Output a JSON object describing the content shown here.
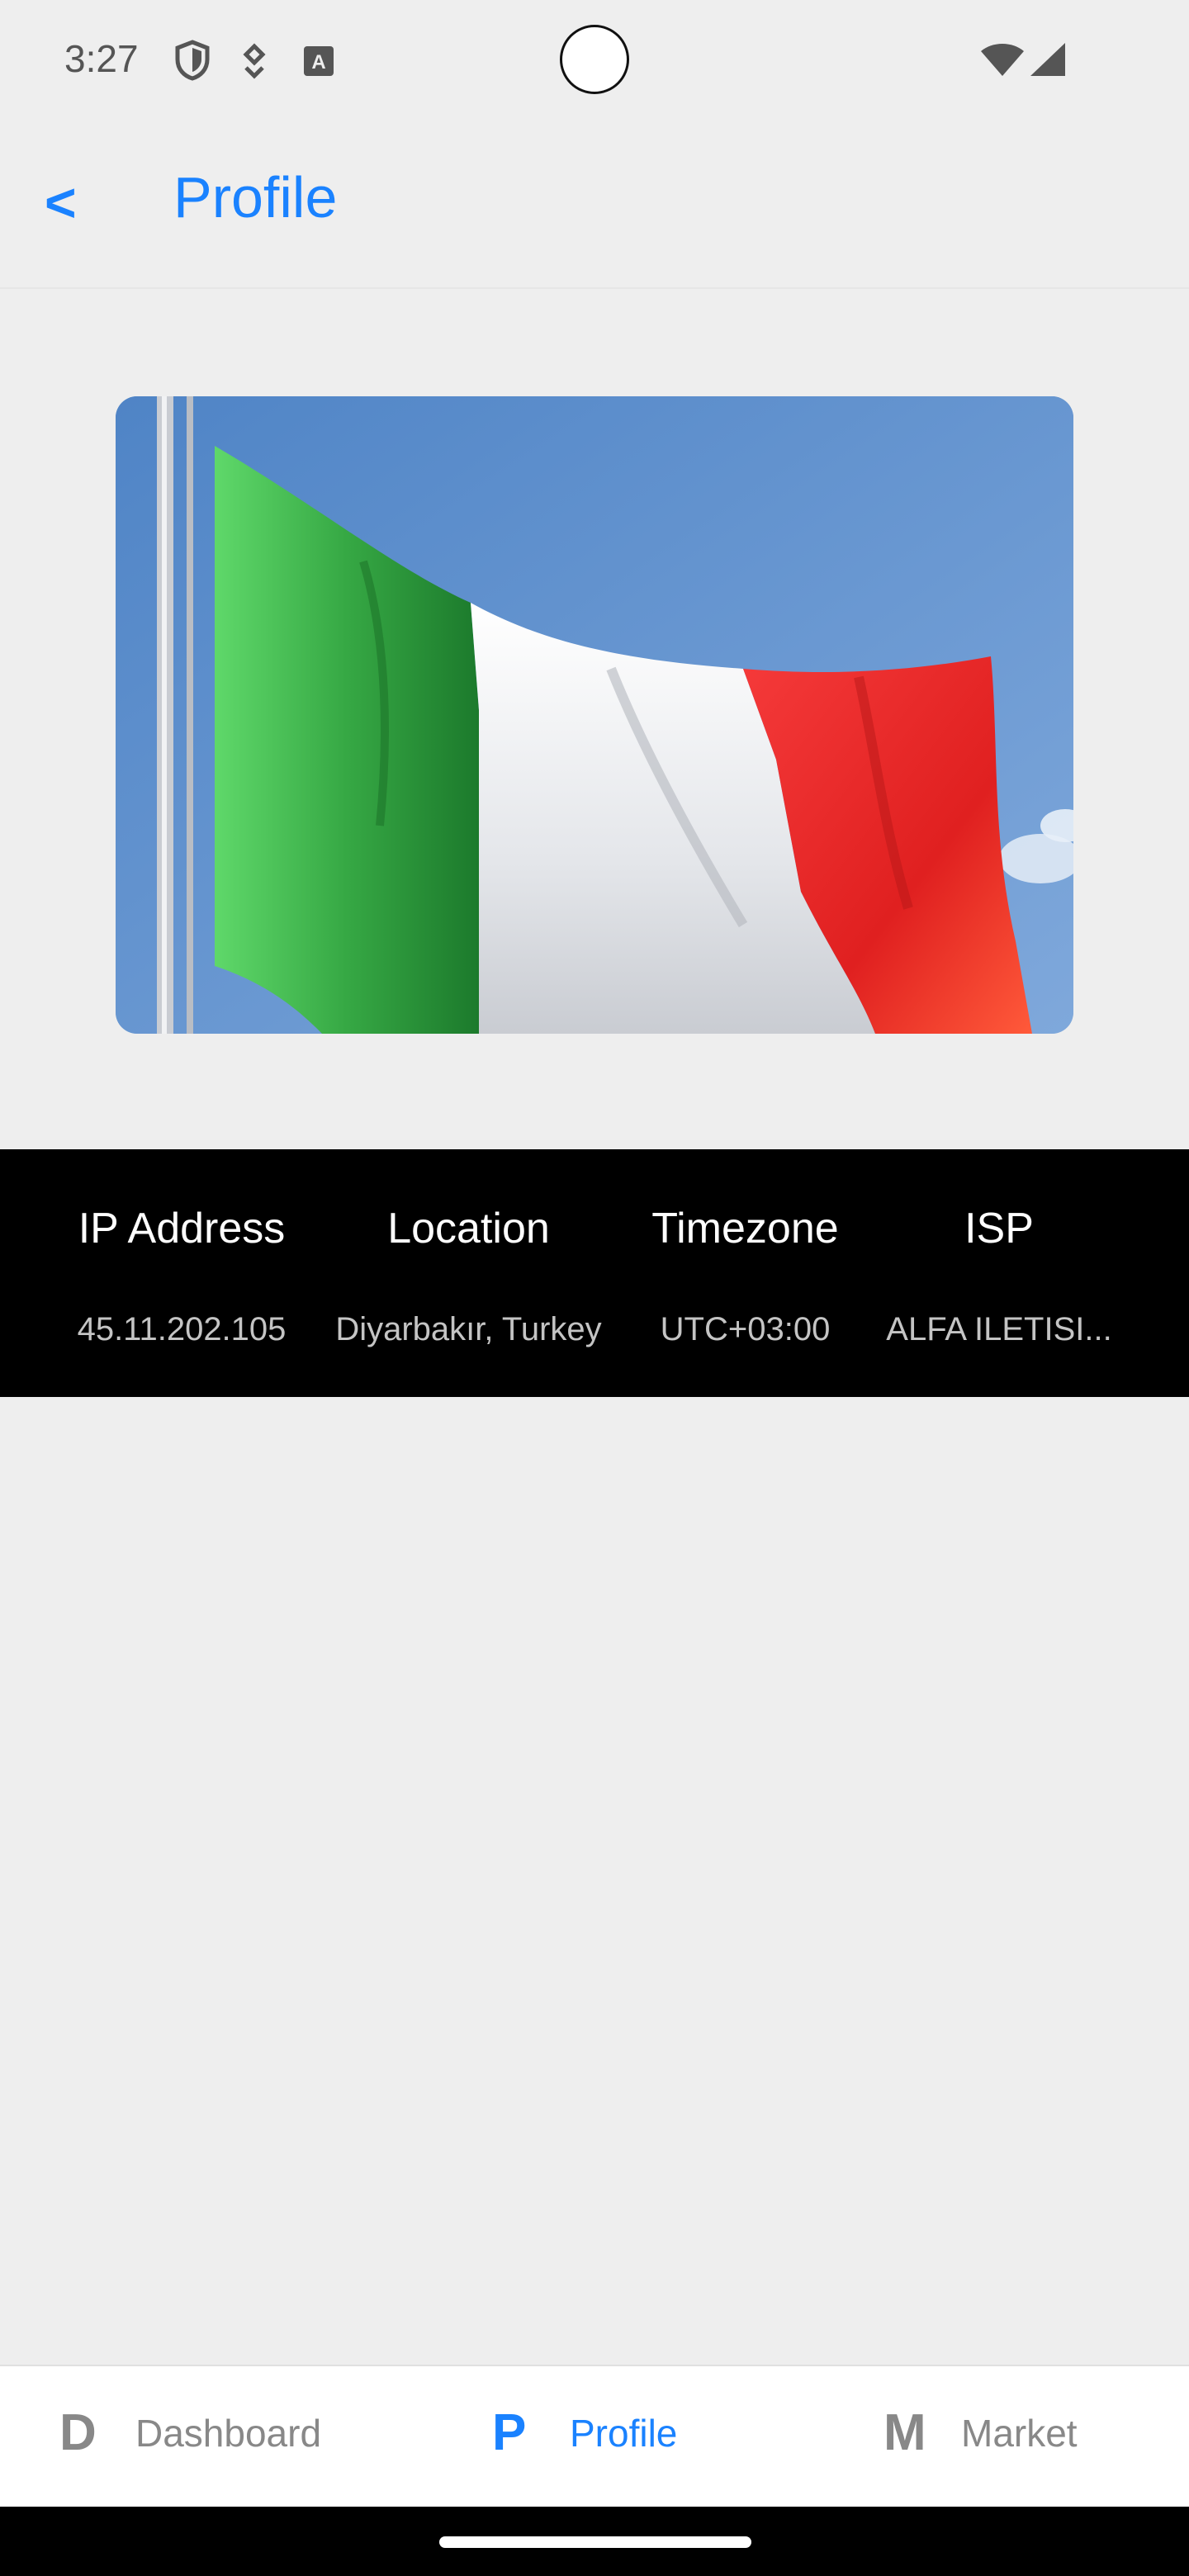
{
  "status_bar": {
    "time": "3:27",
    "icons": [
      "shield-icon",
      "vpn-key-icon",
      "text-a-icon",
      "wifi-icon",
      "signal-icon"
    ]
  },
  "header": {
    "back_label": "<",
    "title": "Profile"
  },
  "flag_image": {
    "subject": "italy-flag",
    "colors": {
      "green": "#2f9c3a",
      "white": "#f2f2f2",
      "red": "#e82828",
      "sky": "#5f90cf"
    }
  },
  "info": {
    "columns": [
      {
        "label": "IP Address",
        "value": "45.11.202.105"
      },
      {
        "label": "Location",
        "value": "Diyarbakır, Turkey"
      },
      {
        "label": "Timezone",
        "value": "UTC+03:00"
      },
      {
        "label": "ISP",
        "value": "ALFA ILETISI..."
      }
    ]
  },
  "bottom_nav": {
    "items": [
      {
        "letter": "D",
        "label": "Dashboard",
        "active": false
      },
      {
        "letter": "P",
        "label": "Profile",
        "active": true
      },
      {
        "letter": "M",
        "label": "Market",
        "active": false
      }
    ]
  },
  "colors": {
    "accent": "#1a82ff",
    "background": "#eeeeee",
    "strip": "#000000"
  }
}
